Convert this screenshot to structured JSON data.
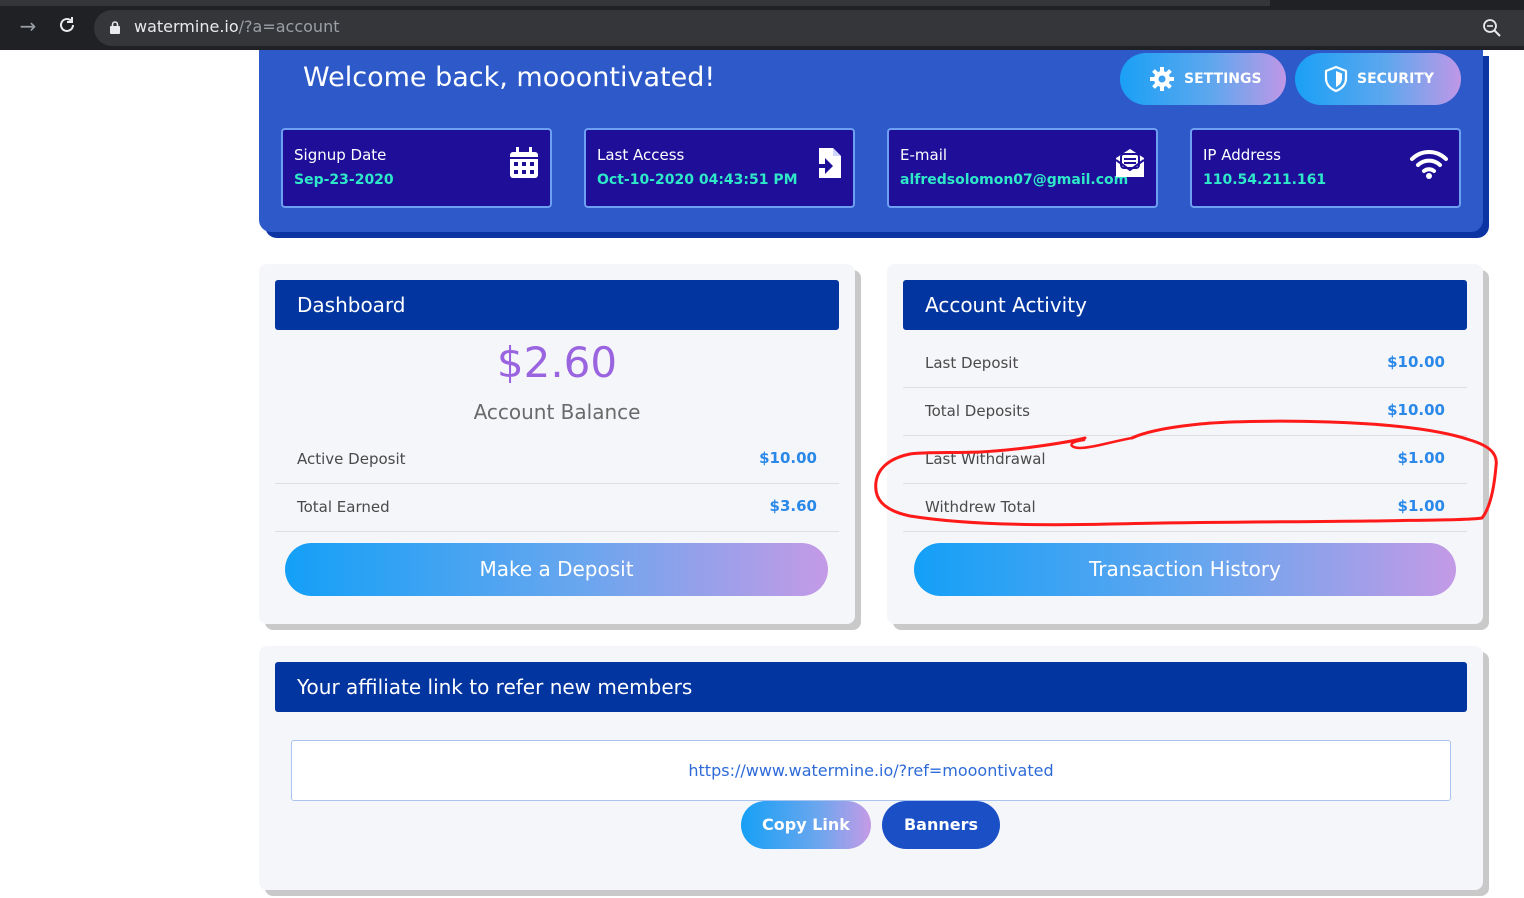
{
  "browser": {
    "url_host": "watermine.io",
    "url_path": "/?a=account"
  },
  "hero": {
    "welcome": "Welcome back, mooontivated!",
    "settings_label": "SETTINGS",
    "security_label": "SECURITY",
    "cards": [
      {
        "label": "Signup Date",
        "value": "Sep-23-2020",
        "icon": "calendar-icon"
      },
      {
        "label": "Last Access",
        "value": "Oct-10-2020 04:43:51 PM",
        "icon": "login-icon"
      },
      {
        "label": "E-mail",
        "value": "alfredsolomon07@gmail.com",
        "icon": "envelope-icon"
      },
      {
        "label": "IP Address",
        "value": "110.54.211.161",
        "icon": "wifi-icon"
      }
    ]
  },
  "dashboard": {
    "title": "Dashboard",
    "balance": "$2.60",
    "balance_label": "Account Balance",
    "rows": [
      {
        "label": "Active Deposit",
        "value": "$10.00"
      },
      {
        "label": "Total Earned",
        "value": "$3.60"
      }
    ],
    "button": "Make a Deposit"
  },
  "activity": {
    "title": "Account Activity",
    "rows": [
      {
        "label": "Last Deposit",
        "value": "$10.00"
      },
      {
        "label": "Total Deposits",
        "value": "$10.00"
      },
      {
        "label": "Last Withdrawal",
        "value": "$1.00"
      },
      {
        "label": "Withdrew Total",
        "value": "$1.00"
      }
    ],
    "button": "Transaction History"
  },
  "affiliate": {
    "title": "Your affiliate link to refer new members",
    "link": "https://www.watermine.io/?ref=mooontivated",
    "copy_label": "Copy Link",
    "banners_label": "Banners"
  },
  "colors": {
    "hero_bg": "#2e5ac9",
    "panel_header": "#0235a0",
    "value_blue": "#2a88e8",
    "annotation_red": "#ff1a1a"
  }
}
